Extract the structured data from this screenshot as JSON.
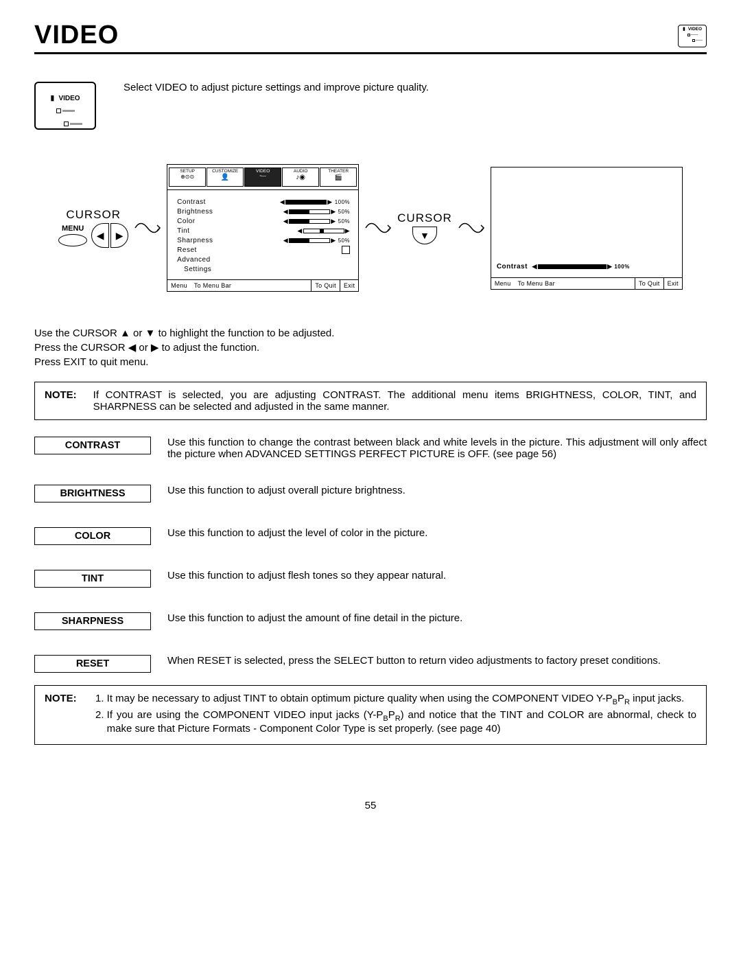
{
  "page": {
    "title": "VIDEO",
    "number": "55"
  },
  "icon": {
    "video_label": "VIDEO"
  },
  "intro": "Select VIDEO to adjust picture settings and improve picture quality.",
  "cursor_label": "CURSOR",
  "menu_label": "MENU",
  "osd": {
    "tabs": {
      "setup": "SETUP",
      "customize": "CUSTOMIZE",
      "video": "VIDEO",
      "audio": "AUDIO",
      "theater": "THEATER"
    },
    "items": {
      "contrast": "Contrast",
      "brightness": "Brightness",
      "color": "Color",
      "tint": "Tint",
      "sharpness": "Sharpness",
      "reset": "Reset",
      "advanced": "Advanced",
      "settings": "Settings"
    },
    "values": {
      "contrast": "100%",
      "brightness": "50%",
      "color": "50%",
      "sharpness": "50%"
    },
    "footer": {
      "menu": "Menu",
      "tomenu": "To Menu Bar",
      "toquit": "To Quit",
      "exit": "Exit"
    },
    "detail_label": "Contrast",
    "detail_value": "100%"
  },
  "instructions": {
    "l1": "Use the CURSOR ▲ or ▼ to highlight the function to be adjusted.",
    "l2": "Press the CURSOR ◀ or ▶ to adjust the function.",
    "l3": "Press EXIT to quit menu."
  },
  "note1": {
    "label": "NOTE:",
    "text": "If CONTRAST is selected, you are adjusting CONTRAST.  The additional menu items BRIGHTNESS, COLOR, TINT, and SHARPNESS can be selected and adjusted in the same manner."
  },
  "functions": {
    "contrast": {
      "label": "CONTRAST",
      "desc": "Use this function to change the contrast between black and white levels in the picture.  This adjustment will only affect the picture when ADVANCED SETTINGS PERFECT PICTURE is OFF. (see page 56)"
    },
    "brightness": {
      "label": "BRIGHTNESS",
      "desc": "Use this function to adjust overall picture brightness."
    },
    "color": {
      "label": "COLOR",
      "desc": "Use this function to adjust the level of color in the picture."
    },
    "tint": {
      "label": "TINT",
      "desc": "Use this function to adjust flesh tones so they appear natural."
    },
    "sharpness": {
      "label": "SHARPNESS",
      "desc": "Use this function to adjust the amount of fine detail in the picture."
    },
    "reset": {
      "label": "RESET",
      "desc": "When RESET is selected, press the SELECT button to return video adjustments to factory preset conditions."
    }
  },
  "note2": {
    "label": "NOTE:",
    "item1_a": "It may be necessary to adjust TINT to obtain optimum picture quality when using the COMPONENT VIDEO Y-P",
    "item1_b": " input jacks.",
    "item2_a": "If you are using the COMPONENT VIDEO input jacks (Y-P",
    "item2_b": ") and notice that the TINT and COLOR are abnormal, check to make sure that Picture Formats - Component Color Type is set properly. (see page 40)",
    "sub_b": "B",
    "sub_r": "R"
  }
}
